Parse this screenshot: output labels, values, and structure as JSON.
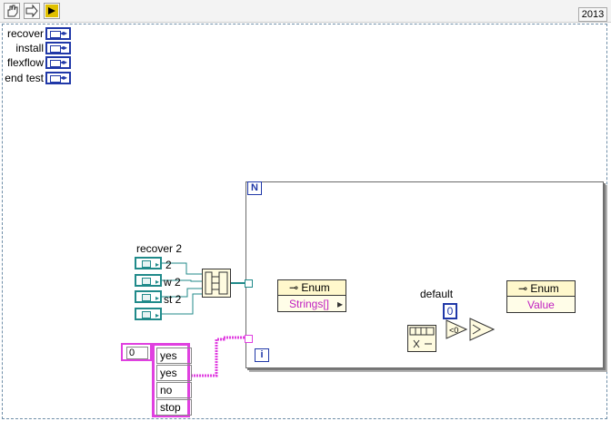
{
  "toolbar": {
    "year": "2013"
  },
  "controls": [
    {
      "label": "recover"
    },
    {
      "label": "install"
    },
    {
      "label": "flexflow"
    },
    {
      "label": "end test"
    }
  ],
  "cluster": {
    "label": "recover 2",
    "items": [
      "2",
      "w 2",
      "st 2"
    ]
  },
  "loop": {
    "count_label": "N",
    "iter_label": "i"
  },
  "enum_node_1": {
    "title": "Enum",
    "output": "Strings[]"
  },
  "enum_node_2": {
    "title": "Enum",
    "output": "Value"
  },
  "default_label": "default",
  "zero_constant": "0",
  "array": {
    "index": "0",
    "items": [
      "yes",
      "yes",
      "no",
      "stop"
    ]
  },
  "colors": {
    "wire_teal": "#208a8a",
    "wire_pink": "#e040e0",
    "control_blue": "#2038a8"
  }
}
